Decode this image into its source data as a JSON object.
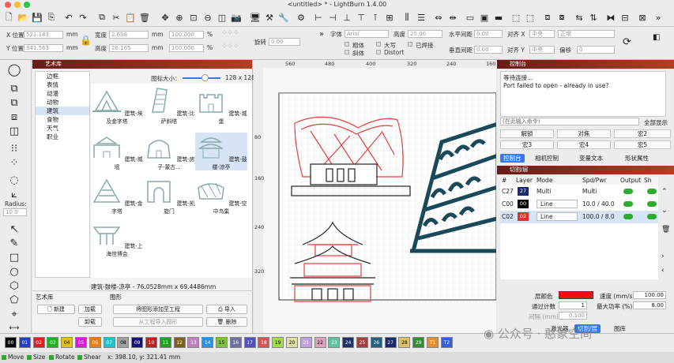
{
  "window": {
    "title": "<untitled> * - LightBurn 1.4.00"
  },
  "props": {
    "xpos_label": "X 位置",
    "xpos": "521.183",
    "ypos_label": "Y 位置",
    "ypos": "341.563",
    "unit": "mm",
    "width_label": "宽度",
    "width": "2.658",
    "height_label": "高度",
    "height": "26.165",
    "scale_w": "100.000",
    "scale_h": "100.000",
    "pct": "%",
    "rotate_label": "旋转",
    "rotate": "0.00",
    "font_label": "字体",
    "font": "Arial",
    "fh_label": "高度",
    "fh": "25.00",
    "hspace_label": "水平间距",
    "hspace": "0.00",
    "align_x_label": "对齐 X",
    "align_x": "中央",
    "normal": "正常",
    "vspace_label": "垂直间距",
    "vspace": "0.00",
    "align_y_label": "对齐 Y",
    "align_y": "中央",
    "offset_label": "偏移",
    "offset": "0",
    "bold": "粗体",
    "italic": "斜体",
    "upper": "大写",
    "distort": "Distort",
    "welded": "已焊接"
  },
  "tools": {
    "radius_label": "Radius:",
    "radius": "10.0"
  },
  "artlib": {
    "title": "艺术库",
    "icon_size_label": "图标大小：",
    "icon_size": "128 x 128",
    "categories": [
      "边框",
      "表情",
      "动漫",
      "动物",
      "建筑",
      "食物",
      "天气",
      "职业"
    ],
    "tiles": [
      "建筑-埃及金字塔",
      "建筑-比萨斜塔",
      "建筑-城堡",
      "建筑-城墙",
      "建筑-房子-蒙古...",
      "建筑-鼓楼-凉亭",
      "建筑-金字塔",
      "建筑-凯旋门",
      "建筑-空中鸟巢",
      "建筑-上海世博会"
    ],
    "selected_info": "建筑-鼓楼-凉亭 - 76.0528mm x 69.4486mm",
    "lib_label": "艺术库",
    "shape_label": "图形",
    "btn_new": "新建",
    "btn_load": "加载",
    "btn_unload": "卸载",
    "btn_add": "将图形添加至工程",
    "btn_import_proj": "从工程导入图形",
    "btn_import": "导入",
    "btn_delete": "删除"
  },
  "canvas": {
    "top_ticks": [
      "560",
      "480",
      "400",
      "320",
      "240",
      "160"
    ],
    "left_ticks": [
      "80",
      "160",
      "240",
      "320"
    ]
  },
  "console": {
    "title": "控制台",
    "line1": "等待连接...",
    "line2": "Port failed to open - already in use?",
    "cmd_placeholder": "(在此输入命令)",
    "show_all": "全部显示",
    "buttons": [
      "解锁",
      "对焦",
      "宏2",
      "宏3",
      "宏4",
      "宏5"
    ],
    "tabs": [
      "控制台",
      "相机控制",
      "变量文本",
      "形状属性"
    ]
  },
  "layers": {
    "title": "切割/层",
    "headers": [
      "#",
      "Layer",
      "Mode",
      "Spd/Pwr",
      "Output",
      "Sh"
    ],
    "rows": [
      {
        "id": "C27",
        "layer": "27",
        "mode": "Multi",
        "spd": "Multi",
        "color": "#1a2a6a"
      },
      {
        "id": "C00",
        "layer": "00",
        "mode": "Line",
        "spd": "10.0 / 40.0",
        "color": "#000000"
      },
      {
        "id": "C02",
        "layer": "02",
        "mode": "Line",
        "spd": "100.0 / 8.0",
        "color": "#e03030"
      }
    ],
    "layer_color_label": "层颜色",
    "speed_label": "速度 (mm/s)",
    "speed": "100.00",
    "passes_label": "通过计数",
    "passes": "1",
    "maxpower_label": "最大功率 (%)",
    "maxpower": "8.00",
    "interval_label": "间隔 (mm)",
    "interval": "0.100",
    "tab_laser": "激光器",
    "tab_cut": "切割/层",
    "tab_lib": "图库"
  },
  "palette": [
    "00",
    "01",
    "02",
    "03",
    "04",
    "05",
    "06",
    "07",
    "08",
    "09",
    "10",
    "11",
    "12",
    "13",
    "14",
    "15",
    "16",
    "17",
    "18",
    "19",
    "20",
    "21",
    "22",
    "23",
    "24",
    "25",
    "26",
    "27",
    "28",
    "29",
    "T1",
    "T2"
  ],
  "palette_colors": [
    "#000000",
    "#2040d0",
    "#e02020",
    "#20b020",
    "#e0c020",
    "#d020d0",
    "#e08020",
    "#20c0d0",
    "#a0a0a0",
    "#101080",
    "#c02020",
    "#20a020",
    "#806020",
    "#c080c0",
    "#3090e0",
    "#80c040",
    "#7070a0",
    "#5050c0",
    "#e05050",
    "#a0e040",
    "#e0e0a0",
    "#c0a0e0",
    "#e0a0c0",
    "#60c0a0",
    "#203060",
    "#a04040",
    "#206080",
    "#1a2a6a",
    "#e0c060",
    "#309030",
    "#e09030",
    "#3060e0"
  ],
  "status": {
    "move": "Move",
    "size": "Size",
    "rotate": "Rotate",
    "shear": "Shear",
    "coords": "x: 398.10, y: 321.41 mm"
  },
  "watermark": "公众号 · 憨象空间"
}
